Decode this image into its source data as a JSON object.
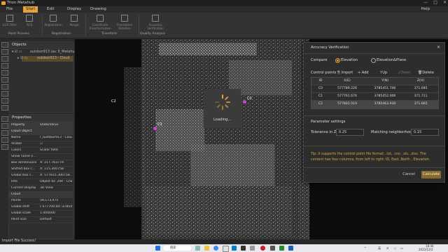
{
  "app": {
    "title": "Trion Metahub"
  },
  "menu": {
    "items": [
      "File",
      "Start",
      "Edit",
      "Display",
      "Drawing"
    ],
    "active": "Start",
    "help": "Help"
  },
  "ribbon": {
    "buttons": [
      "LGR Filter",
      "RCS",
      "Registration",
      "Merge",
      "Coordinate Transformation",
      "Translation Rotation",
      "Accuracy Verification"
    ],
    "groups": [
      "Point Process",
      "Registration",
      "Transform",
      "Quality Analysis"
    ]
  },
  "objects_panel": {
    "title": "Objects",
    "items": [
      "outdoor913 (as: E_Metahu...",
      "outdoor913 - Cloud"
    ]
  },
  "properties_panel": {
    "title": "Properties",
    "headers": [
      "Property",
      "State/Value"
    ],
    "rows": [
      {
        "k": "Cloud Object",
        "v": "",
        "group": true
      },
      {
        "k": "Name",
        "v": "r_outdoor913 - Cloud"
      },
      {
        "k": "Visible",
        "v": "☑"
      },
      {
        "k": "Colors",
        "v": "Scalar field"
      },
      {
        "k": "Show name (i...",
        "v": ""
      },
      {
        "k": "Box dimensions",
        "v": "X: 217.763779"
      },
      {
        "k": "Shifted box c...",
        "v": "X: 115.300758"
      },
      {
        "k": "Global box c...",
        "v": "X: 577815.300758..."
      },
      {
        "k": "Info",
        "v": "Object ID: 294 - Childr"
      },
      {
        "k": "Current Display",
        "v": "3D View"
      },
      {
        "k": "Cloud",
        "v": "",
        "group": true
      },
      {
        "k": "Points",
        "v": "59,173,475"
      },
      {
        "k": "Global shift",
        "v": "(-577700.00;-378540..."
      },
      {
        "k": "Global scale",
        "v": "1.000000"
      },
      {
        "k": "Point size",
        "v": "Default"
      }
    ]
  },
  "viewport": {
    "loading_text": "Loading...",
    "markers": [
      "C0",
      "C1",
      "C2"
    ]
  },
  "dialog": {
    "title": "Accuracy Verification",
    "close": "×",
    "compare_label": "Compare",
    "compare_options": [
      "Elevation",
      "Elevation&Plane"
    ],
    "compare_selected": "Elevation",
    "control_points_label": "Control points",
    "toolbar": {
      "import": "Import",
      "add": "+ Add",
      "up": "Up",
      "down": "Down",
      "delete": "Delete"
    },
    "table_headers": [
      "ID",
      "X(E)",
      "Y(N)",
      "Z(H)"
    ],
    "table_rows": [
      [
        "C0",
        "577789.226",
        "3785451.746",
        "371.685"
      ],
      [
        "C1",
        "577761.676",
        "3785452.006",
        "371.711"
      ],
      [
        "C2",
        "577802.019",
        "3785463.930",
        "371.665"
      ]
    ],
    "selected_row": 2,
    "params_label": "Parameter settings",
    "tolerance_label": "Tolerance in Z",
    "tolerance_value": "0.25",
    "neighborhood_label": "Matching neighborhood",
    "neighborhood_value": "0.15",
    "tip": "Tip: It supports the control point file format: .txt, .csv, .xls, .xlsx. The content has four columns, from left to right: ID, East ,North , Elevation.",
    "cancel": "Cancel",
    "calculate": "Calculate"
  },
  "status": {
    "text": "Import File Success!"
  },
  "taskbar": {
    "search": "搜索",
    "time": "18:44",
    "date": "2022/12/2"
  },
  "colors": {
    "accent": "#e6a23c",
    "tip": "#e6a23c",
    "marker": "#d040d0"
  }
}
